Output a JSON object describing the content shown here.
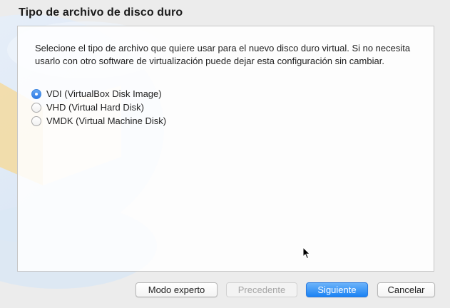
{
  "dialog": {
    "title": "Tipo de archivo de disco duro",
    "description": "Selecione el tipo de archivo que quiere usar para el nuevo disco duro virtual. Si no necesita usarlo con otro software de virtualización puede dejar esta configuración sin cambiar."
  },
  "options": [
    {
      "label": "VDI (VirtualBox Disk Image)",
      "selected": true
    },
    {
      "label": "VHD (Virtual Hard Disk)",
      "selected": false
    },
    {
      "label": "VMDK (Virtual Machine Disk)",
      "selected": false
    }
  ],
  "buttons": {
    "expert": "Modo experto",
    "back": "Precedente",
    "next": "Siguiente",
    "cancel": "Cancelar"
  },
  "colors": {
    "accent": "#1b82f3",
    "window_bg": "#ececec",
    "art_yellow": "#f3dca4",
    "art_blue": "#dde9f7"
  },
  "icons": {
    "cursor": "mouse-pointer-icon"
  }
}
